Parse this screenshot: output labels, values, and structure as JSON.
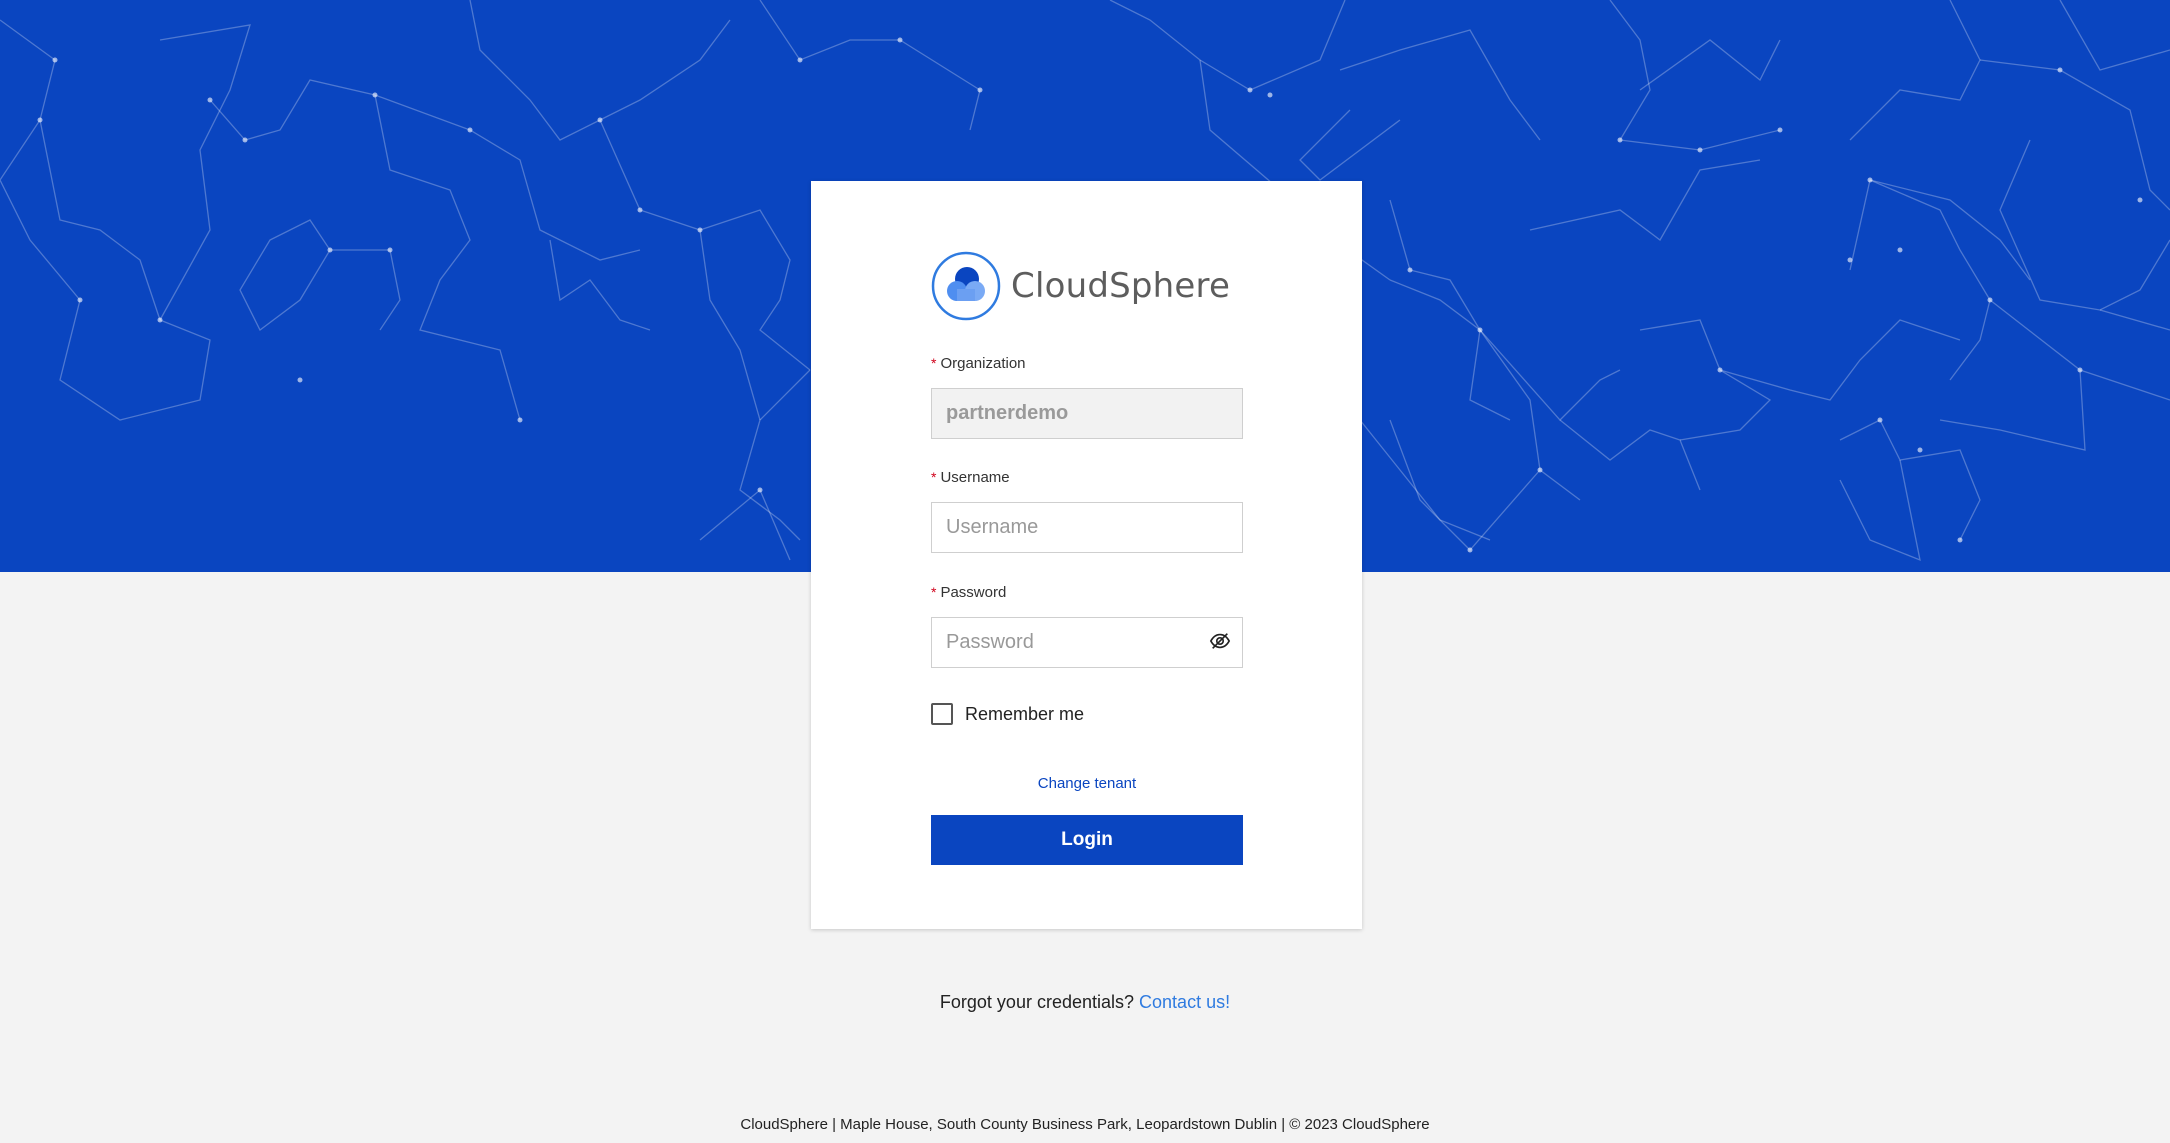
{
  "brand": {
    "name": "CloudSphere",
    "primary_color": "#0a45c0",
    "link_color": "#2f7be0",
    "logo_icon": "cloud-sphere-logo-icon"
  },
  "form": {
    "organization": {
      "label": "Organization",
      "value": "partnerdemo",
      "required": true,
      "disabled": true
    },
    "username": {
      "label": "Username",
      "placeholder": "Username",
      "value": "",
      "required": true
    },
    "password": {
      "label": "Password",
      "placeholder": "Password",
      "value": "",
      "required": true,
      "toggle_icon": "eye-slash-icon"
    },
    "remember_me": {
      "label": "Remember me",
      "checked": false
    },
    "change_tenant_label": "Change tenant",
    "login_label": "Login",
    "required_marker": "*"
  },
  "help": {
    "text": "Forgot your credentials?",
    "link_label": "Contact us!"
  },
  "footer": {
    "text": "CloudSphere | Maple House, South County Business Park, Leopardstown Dublin | © 2023 CloudSphere"
  }
}
